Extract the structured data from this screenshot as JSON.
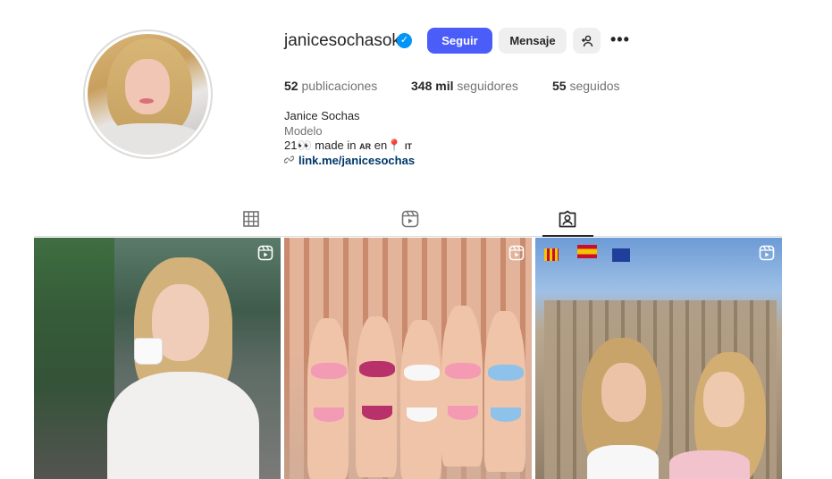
{
  "profile": {
    "username": "janicesochasok",
    "verified": true,
    "follow_label": "Seguir",
    "message_label": "Mensaje",
    "posts_count": "52",
    "posts_label": "publicaciones",
    "followers_count": "348 mil",
    "followers_label": "seguidores",
    "following_count": "55",
    "following_label": "seguidos",
    "full_name": "Janice Sochas",
    "category": "Modelo",
    "bio_prefix": "21👀 made in",
    "bio_country1": "AR",
    "bio_mid": "en📍",
    "bio_country2": "IT",
    "link": "link.me/janicesochas"
  },
  "icons": {
    "verified": "verified-badge-icon",
    "add_user": "add-user-icon",
    "more": "more-options-icon",
    "link": "link-chain-icon",
    "tab_posts": "grid-icon",
    "tab_reels": "reels-icon",
    "tab_tagged": "tagged-icon",
    "reel_badge": "reel-badge-icon"
  },
  "tabs": {
    "active": "tagged"
  },
  "colors": {
    "accent": "#4a5df9",
    "verified": "#0095f6",
    "link": "#00376b"
  }
}
